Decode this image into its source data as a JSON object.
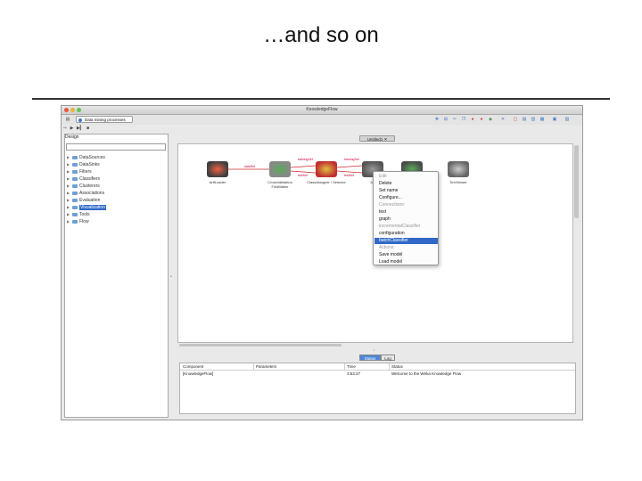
{
  "slide": {
    "title": "…and so on"
  },
  "window": {
    "title": "KnowledgeFlow",
    "tab_label": "Data mining processes",
    "traffic_lights": {
      "close": "#e9563f",
      "minimize": "#e5b43c",
      "zoom": "#61c454"
    }
  },
  "left_panel": {
    "label": "Design",
    "tree": [
      {
        "label": "DataSources",
        "selected": false
      },
      {
        "label": "DataSinks",
        "selected": false
      },
      {
        "label": "Filters",
        "selected": false
      },
      {
        "label": "Classifiers",
        "selected": false
      },
      {
        "label": "Clusterers",
        "selected": false
      },
      {
        "label": "Associations",
        "selected": false
      },
      {
        "label": "Evaluation",
        "selected": false
      },
      {
        "label": "Visualization",
        "selected": true
      },
      {
        "label": "Tools",
        "selected": false
      },
      {
        "label": "Flow",
        "selected": false
      }
    ]
  },
  "flow_tab": {
    "label": "Untitled1"
  },
  "components": [
    {
      "name": "ArffLoader",
      "label": "ArffLoader",
      "icon": "arff-loader-icon"
    },
    {
      "name": "CrossValidationFoldMaker",
      "label": "CrossValidation FoldMaker",
      "icon": "fold-maker-icon"
    },
    {
      "name": "ClassifierSelector",
      "label": "ClassAssigner / Selector",
      "icon": "class-assigner-icon"
    },
    {
      "name": "J48",
      "label": "J48",
      "icon": "classifier-icon"
    },
    {
      "name": "ClassifierPerformanceEvaluator",
      "label": "",
      "icon": "evaluator-icon"
    },
    {
      "name": "TextViewer",
      "label": "TextViewer",
      "icon": "text-viewer-icon"
    }
  ],
  "connections": [
    {
      "label": "dataSet"
    },
    {
      "label": "trainingSet"
    },
    {
      "label": "testSet"
    }
  ],
  "context_menu": {
    "items": [
      {
        "label": "Edit",
        "style": "grey"
      },
      {
        "label": "Delete",
        "style": "normal"
      },
      {
        "label": "Set name",
        "style": "normal"
      },
      {
        "label": "Configure...",
        "style": "normal"
      },
      {
        "label": "Connections:",
        "style": "grey"
      },
      {
        "label": "text",
        "style": "normal"
      },
      {
        "label": "graph",
        "style": "normal"
      },
      {
        "label": "incrementalClassifier",
        "style": "grey"
      },
      {
        "label": "configuration",
        "style": "normal"
      },
      {
        "label": "batchClassifier",
        "style": "highlight"
      },
      {
        "label": "Actions:",
        "style": "grey"
      },
      {
        "label": "Save model",
        "style": "normal"
      },
      {
        "label": "Load model",
        "style": "normal"
      }
    ]
  },
  "bottom": {
    "tabs": [
      {
        "label": "Status",
        "active": true
      },
      {
        "label": "Log",
        "active": false
      }
    ],
    "columns": [
      "Component",
      "Parameters",
      "Time",
      "Status"
    ],
    "rows": [
      {
        "component": "[KnowledgeFlow]",
        "parameters": "",
        "time": "3:53:27",
        "status": "Welcome to the Weka Knowledge Flow"
      }
    ]
  }
}
